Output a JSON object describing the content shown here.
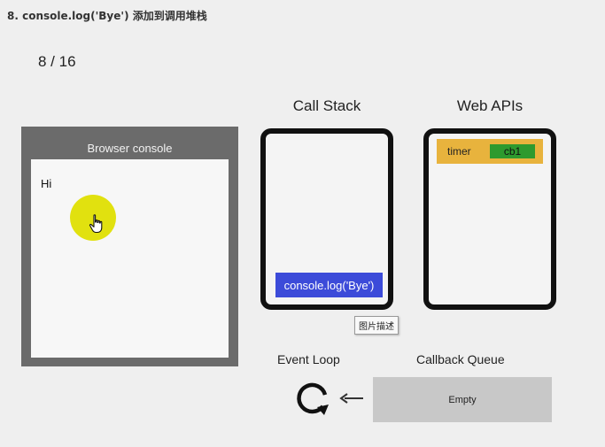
{
  "header": {
    "heading": "8. console.log('Bye') 添加到调用堆栈",
    "counter": "8 / 16"
  },
  "browser_console": {
    "title": "Browser console",
    "lines": [
      "Hi"
    ]
  },
  "call_stack": {
    "title": "Call Stack",
    "frames": [
      "console.log('Bye')"
    ]
  },
  "web_apis": {
    "title": "Web APIs",
    "timer_label": "timer",
    "timer_callback": "cb1"
  },
  "tooltip": "图片描述",
  "event_loop": {
    "label": "Event Loop"
  },
  "callback_queue": {
    "label": "Callback Queue",
    "content": "Empty"
  },
  "colors": {
    "stack_frame": "#3c4bd9",
    "timer_row": "#e8b33d",
    "timer_callback": "#2e9a2e",
    "cursor_highlight": "#e1e10f",
    "console_frame": "#6b6b6b",
    "queue_box": "#c8c8c8"
  },
  "icons": {
    "cursor": "hand-pointer-icon",
    "event_loop": "loop-arrow-icon",
    "queue_arrow": "arrow-left-icon"
  }
}
